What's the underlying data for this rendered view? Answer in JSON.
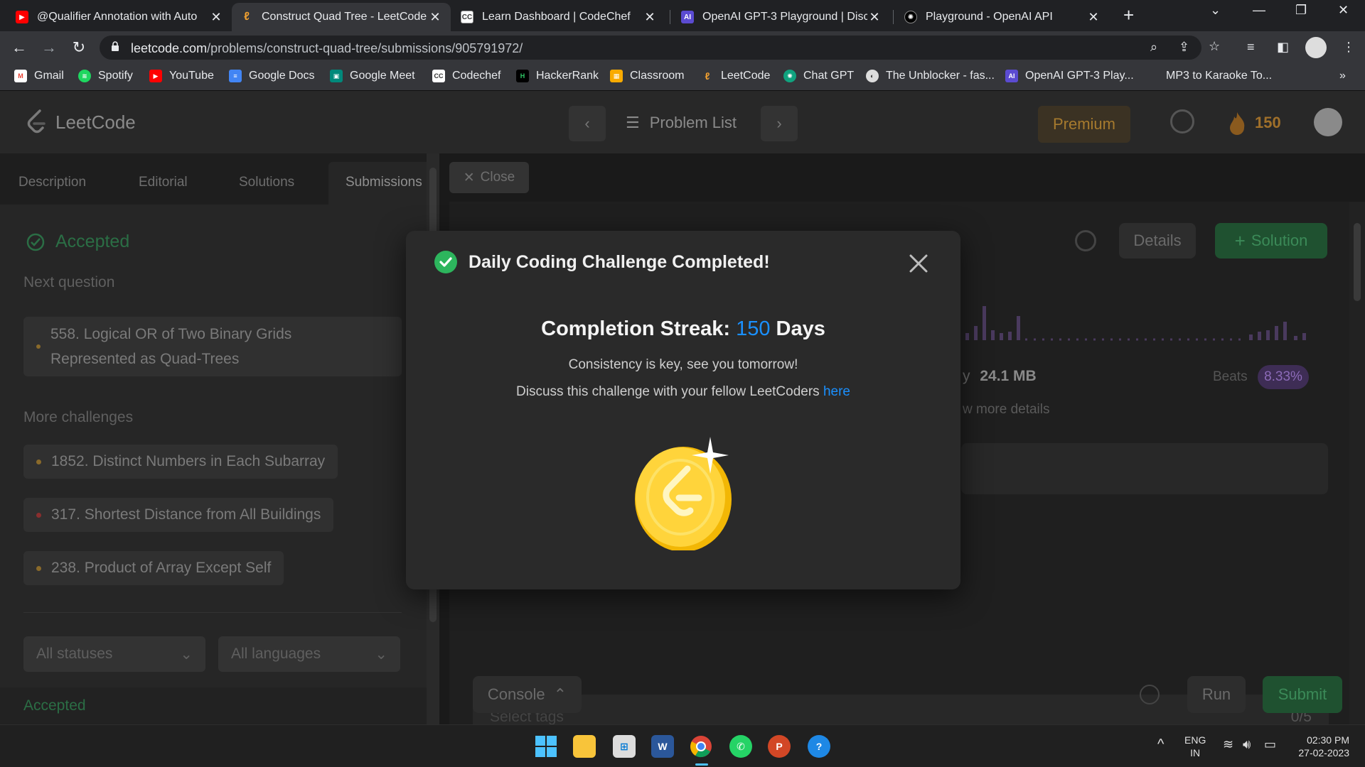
{
  "browser": {
    "tabs": [
      {
        "title": "@Qualifier Annotation with Auto",
        "icon": "youtube-icon"
      },
      {
        "title": "Construct Quad Tree - LeetCode",
        "icon": "leetcode-icon"
      },
      {
        "title": "Learn Dashboard | CodeChef",
        "icon": "codechef-icon"
      },
      {
        "title": "OpenAI GPT-3 Playground | Disc",
        "icon": "openai-demo-icon"
      },
      {
        "title": "Playground - OpenAI API",
        "icon": "openai-icon"
      }
    ],
    "url_domain": "leetcode.com",
    "url_path": "/problems/construct-quad-tree/submissions/905791972/",
    "bookmarks": [
      "Gmail",
      "Spotify",
      "YouTube",
      "Google Docs",
      "Google Meet",
      "Codechef",
      "HackerRank",
      "Classroom",
      "LeetCode",
      "Chat GPT",
      "The Unblocker - fas...",
      "OpenAI GPT-3 Play...",
      "MP3 to Karaoke To..."
    ]
  },
  "lc": {
    "logo": "LeetCode",
    "problem_list": "Problem List",
    "premium": "Premium",
    "streak": "150",
    "tabs": [
      "Description",
      "Editorial",
      "Solutions",
      "Submissions"
    ],
    "close": "Close",
    "status": "Accepted",
    "next_question_label": "Next question",
    "next_question_line1": "558. Logical OR of Two Binary Grids",
    "next_question_line2": "Represented as Quad-Trees",
    "more_challenges_label": "More challenges",
    "challenges": [
      "1852. Distinct Numbers in Each Subarray",
      "317. Shortest Distance from All Buildings",
      "238. Product of Array Except Self"
    ],
    "filter_status": "All statuses",
    "filter_lang": "All languages",
    "list_accepted": "Accepted",
    "details": "Details",
    "solution": "Solution",
    "memory_prefix": "y",
    "memory": "24.1 MB",
    "beats_label": "Beats",
    "beats": "8.33%",
    "more_details": "w more details",
    "select_tags": "Select tags",
    "tags_count": "0/5",
    "console": "Console",
    "run": "Run",
    "submit": "Submit"
  },
  "modal": {
    "title": "Daily Coding Challenge Completed!",
    "streak_label": "Completion Streak:",
    "streak_value": "150",
    "streak_unit": "Days",
    "message": "Consistency is key, see you tomorrow!",
    "discuss": "Discuss this challenge with your fellow LeetCoders",
    "discuss_link": "here"
  },
  "taskbar": {
    "lang": "ENG",
    "region": "IN",
    "time": "02:30 PM",
    "date": "27-02-2023"
  },
  "colors": {
    "accent_green": "#2db55d",
    "link_blue": "#1a90ff",
    "coin_gold": "#ffd43b"
  }
}
